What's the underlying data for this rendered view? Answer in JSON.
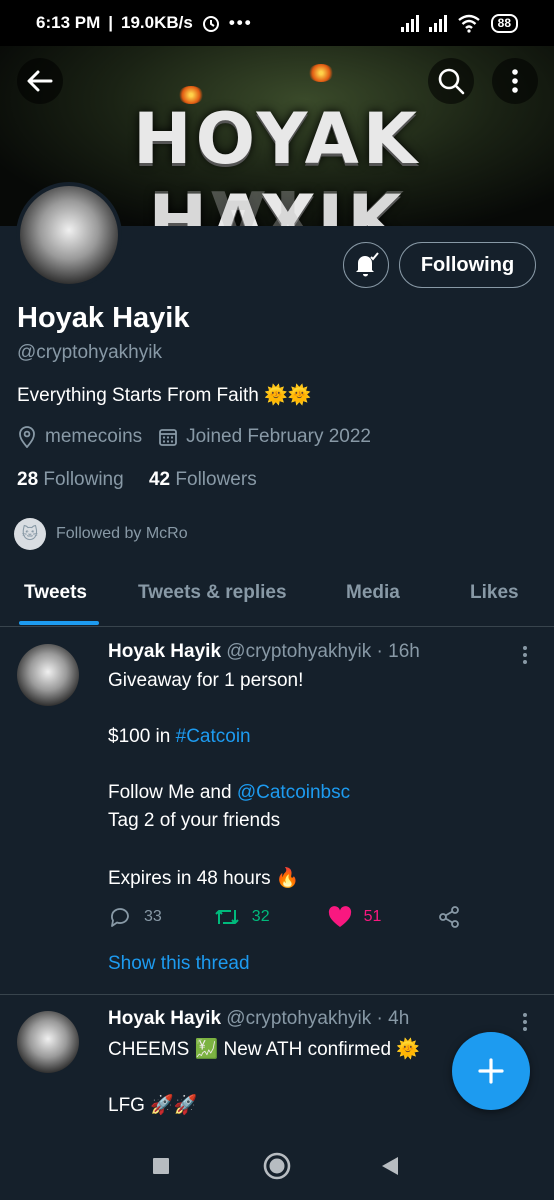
{
  "status_bar": {
    "time": "6:13 PM",
    "speed": "19.0KB/s",
    "battery": "88"
  },
  "banner": {
    "text": "HOYAK HAYIK"
  },
  "profile": {
    "name": "Hoyak Hayik",
    "handle": "@cryptohyakhyik",
    "bio": "Everything Starts From Faith 🌞🌞",
    "location": "memecoins",
    "joined": "Joined February 2022",
    "following_count": "28",
    "following_label": "Following",
    "followers_count": "42",
    "followers_label": "Followers",
    "followed_by": "Followed by McRo",
    "follow_button": "Following"
  },
  "tabs": [
    {
      "label": "Tweets"
    },
    {
      "label": "Tweets & replies"
    },
    {
      "label": "Media"
    },
    {
      "label": "Likes"
    }
  ],
  "tweets": [
    {
      "name": "Hoyak Hayik",
      "meta": "@cryptohyakhyik · 16h",
      "line1": "Giveaway for 1 person!",
      "line2_pre": "$100 in ",
      "line2_link": "#Catcoin",
      "line3_pre": "Follow Me and ",
      "line3_link": "@Catcoinbsc",
      "line4": "Tag 2 of your friends",
      "line5": "Expires in 48 hours 🔥",
      "replies": "33",
      "retweets": "32",
      "likes": "51",
      "show_thread": "Show this thread"
    },
    {
      "name": "Hoyak Hayik",
      "meta": "@cryptohyakhyik · 4h",
      "line1": "CHEEMS 💹 New ATH confirmed 🌞",
      "line2": "LFG 🚀🚀"
    }
  ],
  "colors": {
    "background": "#15202b",
    "accent": "#1d9bf0",
    "retweet": "#00ba7c",
    "like": "#f91880",
    "muted": "#8899a6"
  }
}
